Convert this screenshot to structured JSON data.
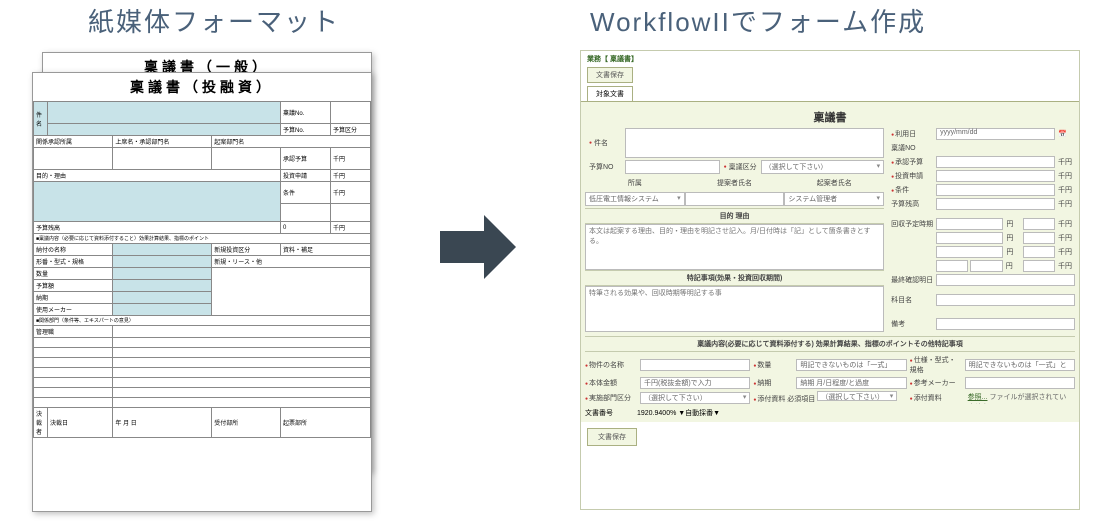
{
  "titles": {
    "left": "紙媒体フォーマット",
    "right": "WorkflowIIでフォーム作成"
  },
  "paper": {
    "back_title": "稟議書（一般）",
    "front_title": "稟議書（投融資）"
  },
  "paper_front": {
    "rows": {
      "r1a": "件名",
      "r1b": "稟議No.",
      "r2a": "",
      "r2b": "予算No.",
      "r2c": "予算区分",
      "r3a": "関係承認所属",
      "r3b": "上席名・承認部門名",
      "r3c": "起案部門名",
      "r4a": "承認予算",
      "r4b": "千円",
      "r5a": "目的・理由",
      "r5b": "投資申請",
      "r5c": "千円",
      "r6a": "条件",
      "r6b": "千円",
      "r7a": "予算残高",
      "r7b": "0",
      "r7c": "千円",
      "sec2": "■稟議内容（必要に応じて資料添付すること）効果計算結果、指標のポイント",
      "r8a": "納付の名称",
      "r8b": "新規投資区分",
      "r8c": "資料・補足",
      "r9a": "形番・型式・規格",
      "r9b": "新規・リース・他",
      "r10": "数量",
      "r11": "予算額",
      "r12": "納期",
      "r13": "使用メーカー",
      "sec3": "■関係部門（条件等、エキスパートの意見）",
      "r14": "管理職",
      "foot1": "決裁者",
      "foot2": "決裁日",
      "foot3": "年",
      "foot4": "月",
      "foot5": "日",
      "foot6": "受付部所",
      "foot7": "起票部所"
    }
  },
  "app": {
    "breadcrumb": "業務【 稟議書】",
    "save_btn": "文書保存",
    "tab": "対象文書",
    "form_title": "稟議書",
    "fields": {
      "kenmei": "件名",
      "riyoubi": "利用日",
      "riyoubi_val": "yyyy/mm/dd",
      "ringino": "稟議NO",
      "yosanno": "予算NO",
      "ringikubun": "稟議区分",
      "ringikubun_val": "（選択して下さい）",
      "shoninyosan": "承認予算",
      "sen": "千円",
      "shozoku": "所属",
      "teiansha": "提案者氏名",
      "kianshashimei": "起案者氏名",
      "shozoku_val": "低圧電工情報システム",
      "kiansha_val": "システム管理者",
      "toushishinsei": "投資申請",
      "mokuteki_hdr": "目的 理由",
      "mokuteki_ph": "本文は起案する理由、目的・理由を明記させ記入。月/日付時は「記」として箇条書きとする。",
      "jouken": "条件",
      "yosanzandaka": "予算残高",
      "kaishuu": "回収予定時期",
      "kan": "円",
      "tokki_hdr": "特記事項(効果・投資回収期間)",
      "tokki_ph": "特筆される効果や、回収時期等明記する事",
      "saisyuukakunin": "最終確認明日",
      "kamoku": "科目名",
      "bikou": "備考",
      "naiyou_hdr": "稟議内容(必要に応じて資料添付する) 効果計算結果、指標のポイントその他特記事項",
      "b_nouhin": "物件の名称",
      "b_suuryou": "数量",
      "b_suuryou_ph": "明記できないものは「一式」",
      "b_shiyou": "仕様・型式・規格",
      "b_shiyou_ph": "明記できないものは「一式」とする",
      "b_hontai": "本体金額",
      "b_hontai_ph": "千円(税抜金額)で入力",
      "b_nouki": "納期",
      "b_nouki_ph": "納期 月/日程度/と過度",
      "b_maker": "参考メーカー",
      "b_jisshi": "実施部門区分",
      "b_jisshi_val": "（選択して下さい）",
      "b_tenpu": "添付資料 必須項目",
      "b_tenpu_val": "（選択して下さい）",
      "b_file": "添付資料",
      "b_file_link": "参照...",
      "b_file_msg": "ファイルが選択されていません。",
      "bunshono": "文書番号",
      "bunshono_val": "1920.9400% ▼自動採番▼"
    }
  }
}
